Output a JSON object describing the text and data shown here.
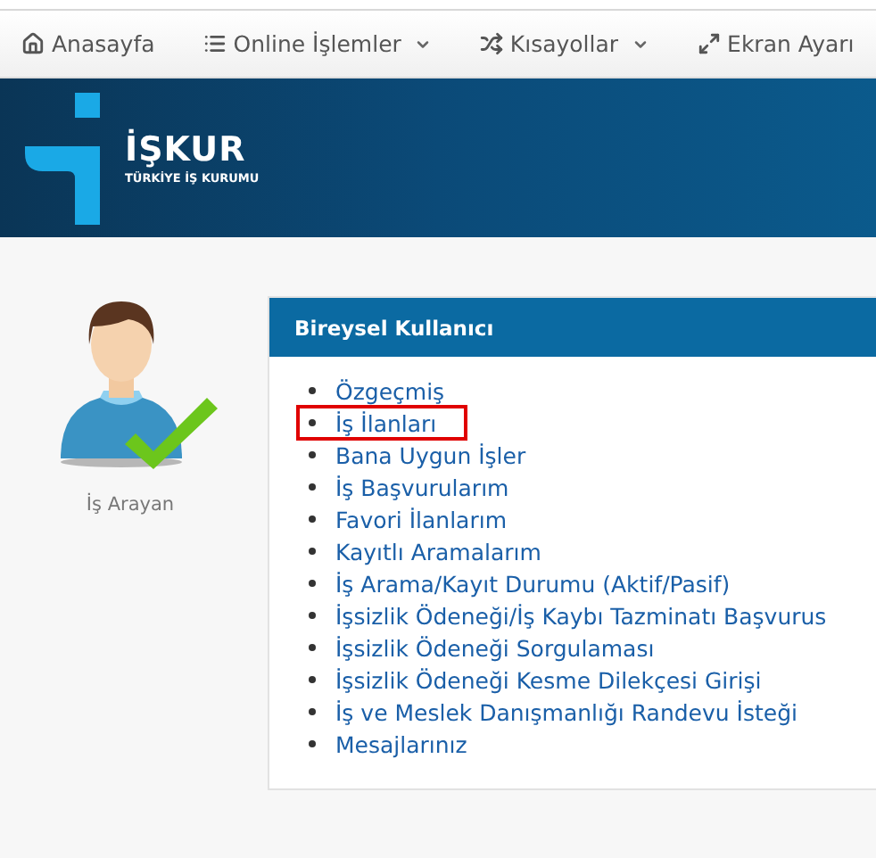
{
  "navbar": {
    "items": [
      {
        "label": "Anasayfa",
        "kind": "home",
        "dropdown": false
      },
      {
        "label": "Online İşlemler",
        "kind": "list",
        "dropdown": true
      },
      {
        "label": "Kısayollar",
        "kind": "shuffle",
        "dropdown": true
      },
      {
        "label": "Ekran Ayarı",
        "kind": "expand",
        "dropdown": false
      }
    ]
  },
  "banner": {
    "logo_title": "İŞKUR",
    "logo_subtitle": "TÜRKİYE İŞ KURUMU"
  },
  "profile": {
    "role": "İş Arayan"
  },
  "panel": {
    "title": "Bireysel Kullanıcı",
    "links": [
      {
        "label": "Özgeçmiş",
        "highlighted": false
      },
      {
        "label": "İş İlanları",
        "highlighted": true
      },
      {
        "label": "Bana Uygun İşler",
        "highlighted": false
      },
      {
        "label": "İş Başvurularım",
        "highlighted": false
      },
      {
        "label": "Favori İlanlarım",
        "highlighted": false
      },
      {
        "label": "Kayıtlı Aramalarım",
        "highlighted": false
      },
      {
        "label": "İş Arama/Kayıt Durumu (Aktif/Pasif)",
        "highlighted": false
      },
      {
        "label": "İşsizlik Ödeneği/İş Kaybı Tazminatı Başvurus",
        "highlighted": false
      },
      {
        "label": "İşsizlik Ödeneği Sorgulaması",
        "highlighted": false
      },
      {
        "label": "İşsizlik Ödeneği Kesme Dilekçesi Girişi",
        "highlighted": false
      },
      {
        "label": "İş ve Meslek Danışmanlığı Randevu İsteği",
        "highlighted": false
      },
      {
        "label": "Mesajlarınız",
        "highlighted": false
      }
    ]
  }
}
